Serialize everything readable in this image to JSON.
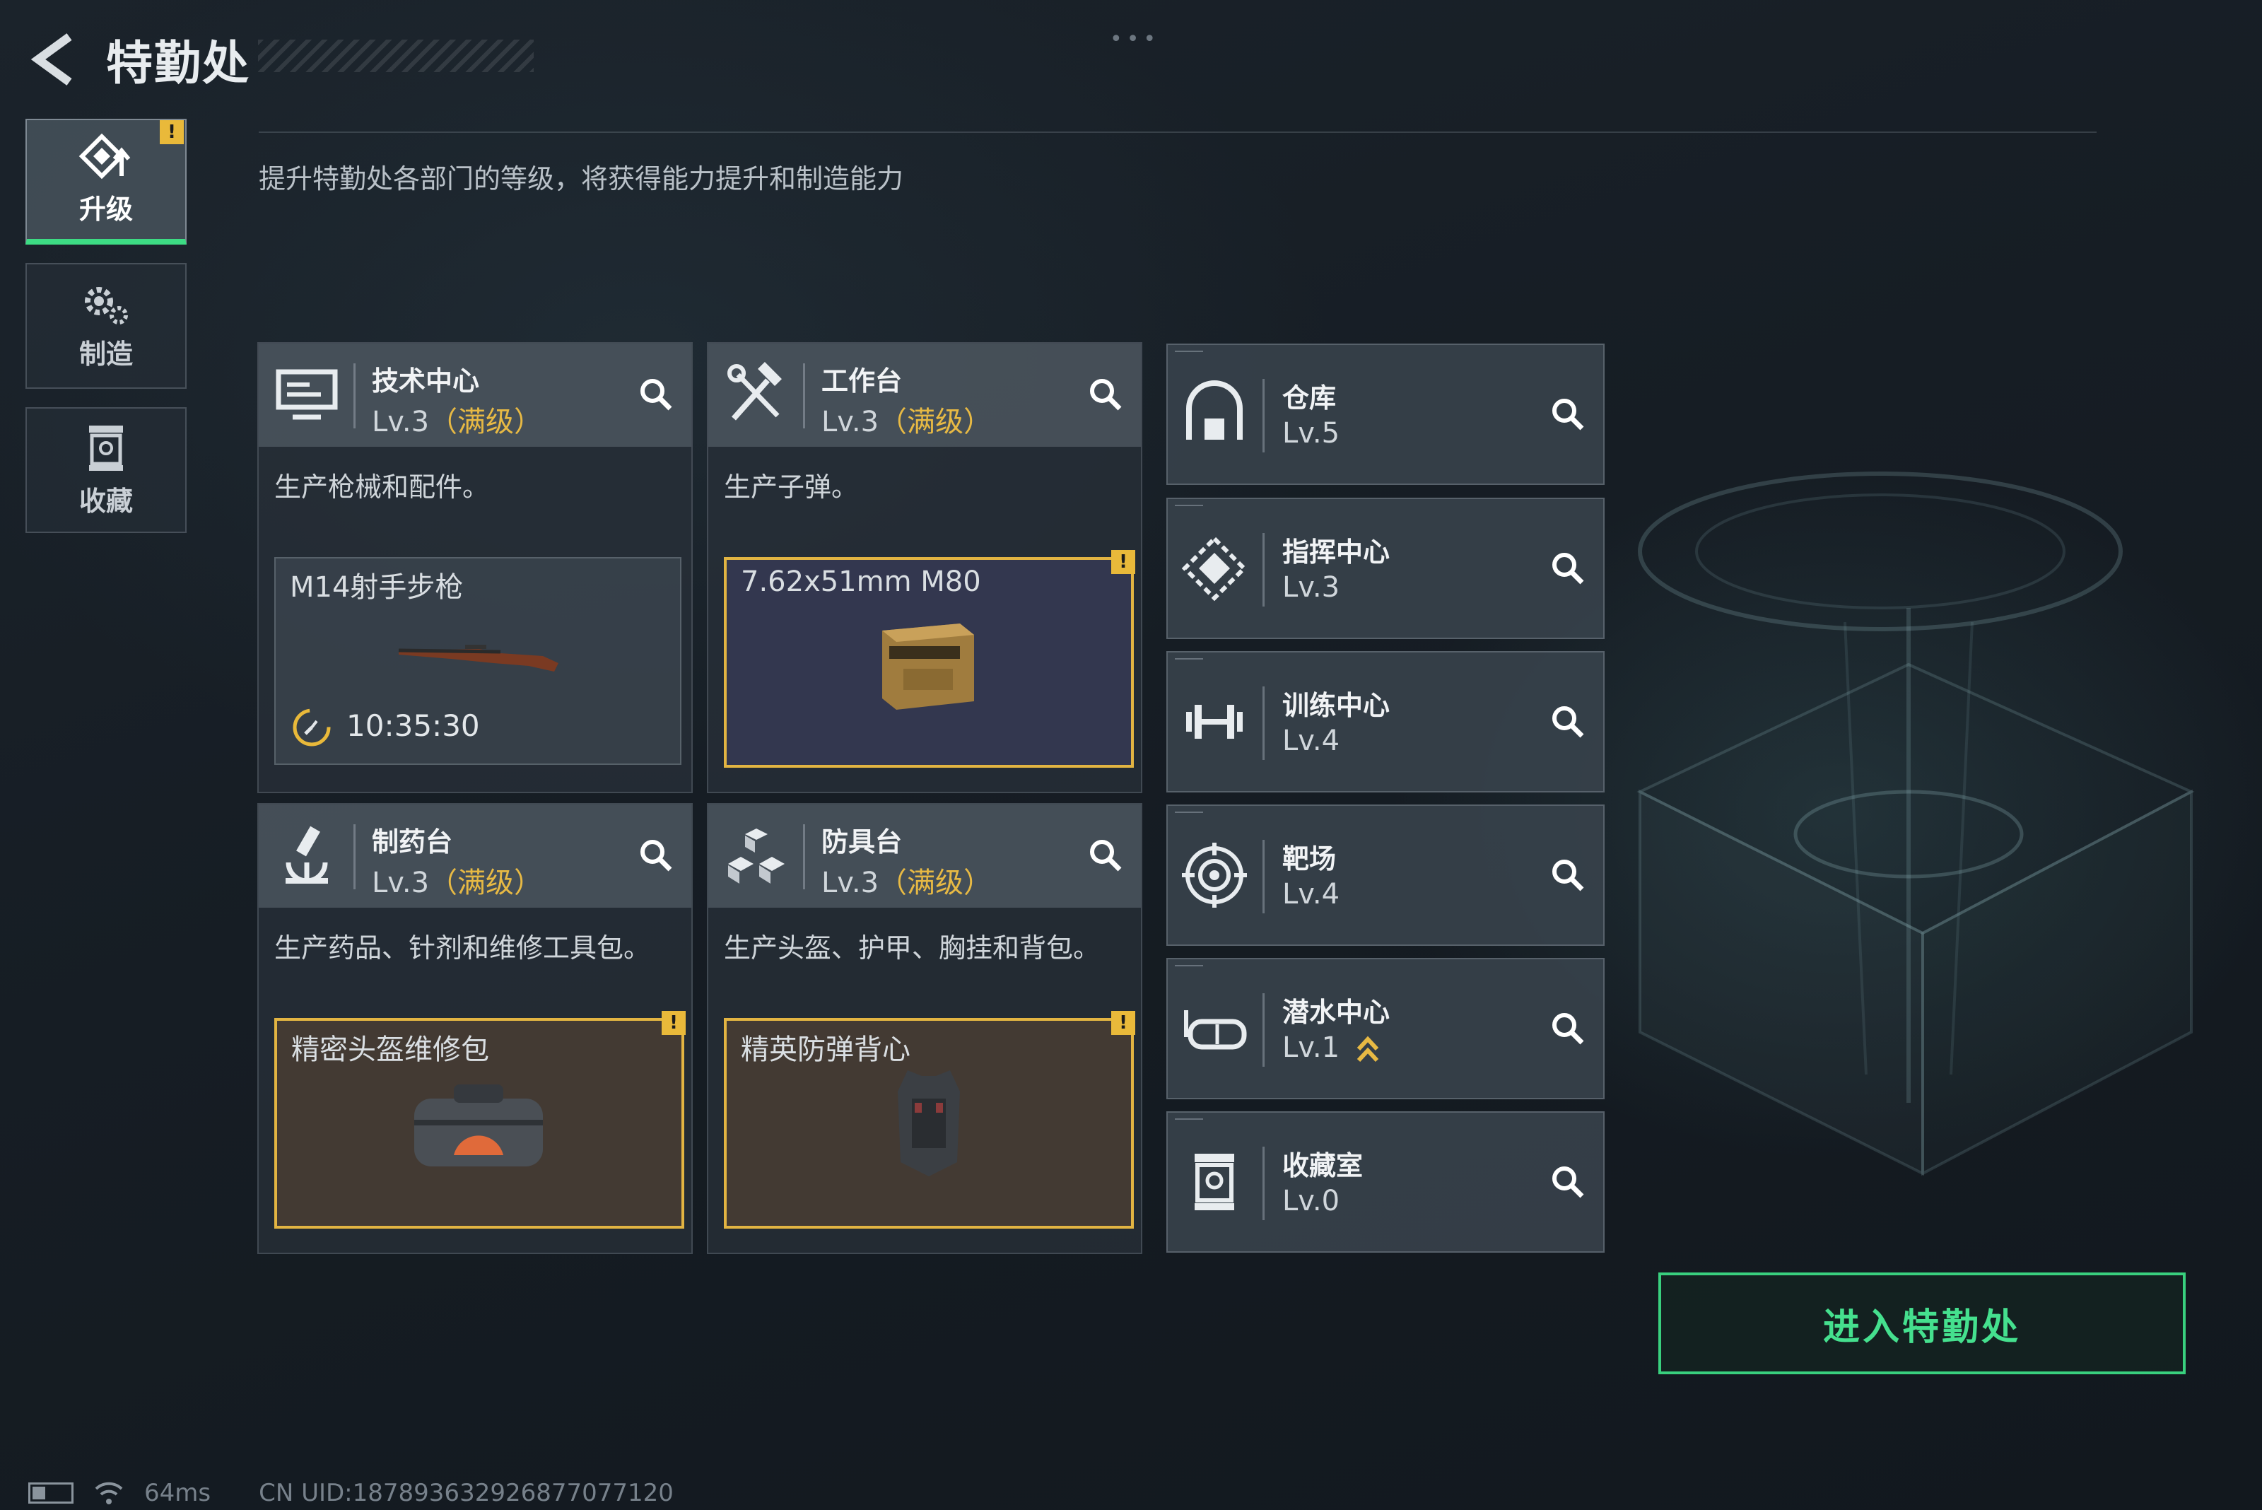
{
  "header": {
    "title": "特勤处",
    "back_icon": "chevron-left-icon"
  },
  "nav": [
    {
      "label": "升级",
      "icon": "upgrade-icon",
      "active": true,
      "warning": "!"
    },
    {
      "label": "制造",
      "icon": "gears-icon",
      "active": false
    },
    {
      "label": "收藏",
      "icon": "trophy-case-icon",
      "active": false
    }
  ],
  "subtitle": "提升特勤处各部门的等级，将获得能力提升和制造能力",
  "facilities": [
    {
      "name": "技术中心",
      "level": "Lv.3",
      "max": "（满级）",
      "icon": "monitor-icon",
      "desc": "生产枪械和配件。",
      "slot": {
        "item": "M14射手步枪",
        "timer": "10:35:30",
        "state": "producing"
      }
    },
    {
      "name": "工作台",
      "level": "Lv.3",
      "max": "（满级）",
      "icon": "hammer-wrench-icon",
      "desc": "生产子弹。",
      "slot": {
        "item": "7.62x51mm M80",
        "state": "ready",
        "warning": "!"
      }
    },
    {
      "name": "制药台",
      "level": "Lv.3",
      "max": "（满级）",
      "icon": "microscope-icon",
      "desc": "生产药品、针剂和维修工具包。",
      "slot": {
        "item": "精密头盔维修包",
        "state": "ready",
        "warning": "!"
      }
    },
    {
      "name": "防具台",
      "level": "Lv.3",
      "max": "（满级）",
      "icon": "cubes-icon",
      "desc": "生产头盔、护甲、胸挂和背包。",
      "slot": {
        "item": "精英防弹背心",
        "state": "ready",
        "warning": "!"
      }
    }
  ],
  "rooms": [
    {
      "name": "仓库",
      "level": "Lv.5",
      "icon": "warehouse-icon"
    },
    {
      "name": "指挥中心",
      "level": "Lv.3",
      "icon": "command-diamond-icon"
    },
    {
      "name": "训练中心",
      "level": "Lv.4",
      "icon": "dumbbell-icon"
    },
    {
      "name": "靶场",
      "level": "Lv.4",
      "icon": "target-icon"
    },
    {
      "name": "潜水中心",
      "level": "Lv.1",
      "icon": "diving-mask-icon",
      "upgradable": true
    },
    {
      "name": "收藏室",
      "level": "Lv.0",
      "icon": "trophy-case-icon"
    }
  ],
  "enter_button": "进入特勤处",
  "footer": {
    "ping": "64ms",
    "uid": "CN UID:187893632926877077120"
  },
  "colors": {
    "accent_green": "#3ddc84",
    "warning_yellow": "#e9b93a",
    "max_level": "#e7b944"
  }
}
